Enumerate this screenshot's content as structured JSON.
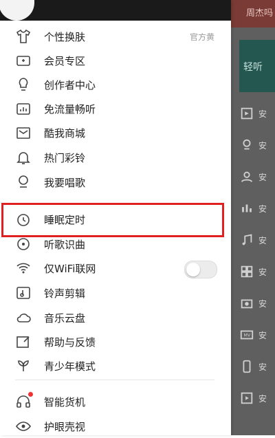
{
  "background": {
    "top_text": "周杰吗",
    "green_text": "轻听"
  },
  "drawer": {
    "items": [
      {
        "label": "个性换肤",
        "right_text": "官方黄"
      },
      {
        "label": "会员专区"
      },
      {
        "label": "创作者中心"
      },
      {
        "label": "免流量畅听"
      },
      {
        "label": "酷我商城"
      },
      {
        "label": "热门彩铃"
      },
      {
        "label": "我要唱歌"
      },
      {
        "label": "睡眠定时"
      },
      {
        "label": "听歌识曲"
      },
      {
        "label": "仅WiFi联网"
      },
      {
        "label": "铃声剪辑"
      },
      {
        "label": "音乐云盘"
      },
      {
        "label": "帮助与反馈"
      },
      {
        "label": "青少年模式"
      },
      {
        "label": "智能货机"
      },
      {
        "label": "护眼壳视"
      }
    ]
  }
}
